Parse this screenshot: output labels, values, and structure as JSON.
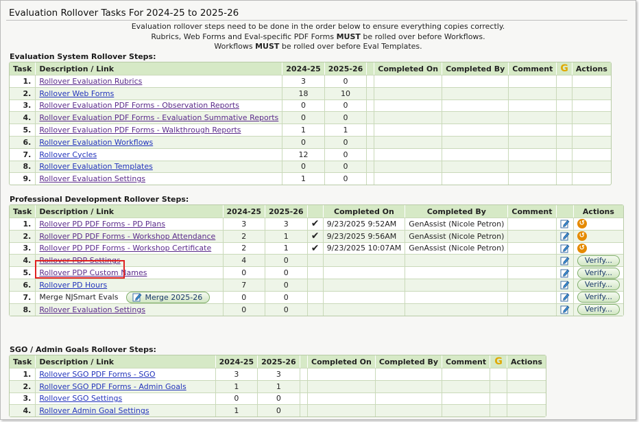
{
  "page": {
    "title": "Evaluation Rollover Tasks For 2024-25 to 2025-26",
    "intro_line1": "Evaluation rollover steps need to be done in the order below to ensure everything copies correctly.",
    "intro_line2_pre": "Rubrics, Web Forms and Eval-specific PDF Forms ",
    "intro_line2_bold": "MUST",
    "intro_line2_post": " be rolled over before Workflows.",
    "intro_line3_pre": "Workflows ",
    "intro_line3_bold": "MUST",
    "intro_line3_post": " be rolled over before Eval Templates."
  },
  "eval_section": {
    "label": "Evaluation System Rollover Steps:",
    "headers": {
      "task": "Task",
      "desc": "Description / Link",
      "y1": "2024-25",
      "y2": "2025-26",
      "completed_on": "Completed On",
      "completed_by": "Completed By",
      "comment": "Comment",
      "g": "G",
      "actions": "Actions"
    },
    "rows": [
      {
        "task": "1.",
        "desc": "Rollover Evaluation Rubrics",
        "y1": "3",
        "y2": "0",
        "visited": true
      },
      {
        "task": "2.",
        "desc": "Rollover Web Forms",
        "y1": "18",
        "y2": "10",
        "visited": false
      },
      {
        "task": "3.",
        "desc": "Rollover Evaluation PDF Forms - Observation Reports",
        "y1": "0",
        "y2": "0",
        "visited": true
      },
      {
        "task": "4.",
        "desc": "Rollover Evaluation PDF Forms - Evaluation Summative Reports",
        "y1": "0",
        "y2": "0",
        "visited": true
      },
      {
        "task": "5.",
        "desc": "Rollover Evaluation PDF Forms - Walkthrough Reports",
        "y1": "1",
        "y2": "1",
        "visited": true
      },
      {
        "task": "6.",
        "desc": "Rollover Evaluation Workflows",
        "y1": "0",
        "y2": "0",
        "visited": false
      },
      {
        "task": "7.",
        "desc": "Rollover Cycles",
        "y1": "12",
        "y2": "0",
        "visited": false
      },
      {
        "task": "8.",
        "desc": "Rollover Evaluation Templates",
        "y1": "0",
        "y2": "0",
        "visited": false
      },
      {
        "task": "9.",
        "desc": "Rollover Evaluation Settings",
        "y1": "1",
        "y2": "0",
        "visited": true
      }
    ]
  },
  "pd_section": {
    "label": "Professional Development Rollover Steps:",
    "headers": {
      "task": "Task",
      "desc": "Description / Link",
      "y1": "2024-25",
      "y2": "2025-26",
      "completed_on": "Completed On",
      "completed_by": "Completed By",
      "comment": "Comment",
      "actions": "Actions"
    },
    "verify_label": "Verify...",
    "merge_label": "Merge 2025-26",
    "rows": [
      {
        "task": "1.",
        "desc": "Rollover PD PDF Forms - PD Plans",
        "y1": "3",
        "y2": "3",
        "done": true,
        "completed_on": "9/23/2025 9:52AM",
        "completed_by": "GenAssist (Nicole Petron)",
        "visited": true
      },
      {
        "task": "2.",
        "desc": "Rollover PD PDF Forms - Workshop Attendance",
        "y1": "2",
        "y2": "1",
        "done": true,
        "completed_on": "9/23/2025 9:56AM",
        "completed_by": "GenAssist (Nicole Petron)",
        "visited": true
      },
      {
        "task": "3.",
        "desc": "Rollover PD PDF Forms - Workshop Certificate",
        "y1": "2",
        "y2": "1",
        "done": true,
        "completed_on": "9/23/2025 10:07AM",
        "completed_by": "GenAssist (Nicole Petron)",
        "visited": true
      },
      {
        "task": "4.",
        "desc": "Rollover PDP Settings",
        "y1": "4",
        "y2": "0",
        "done": false,
        "visited": true
      },
      {
        "task": "5.",
        "desc": "Rollover PDP Custom Names",
        "y1": "0",
        "y2": "0",
        "done": false,
        "visited": true
      },
      {
        "task": "6.",
        "desc": "Rollover PD Hours",
        "y1": "7",
        "y2": "0",
        "done": false,
        "visited": false
      },
      {
        "task": "7.",
        "desc": "Merge NJSmart Evals",
        "y1": "0",
        "y2": "0",
        "done": false,
        "is_merge": true
      },
      {
        "task": "8.",
        "desc": "Rollover Evaluation Settings",
        "y1": "0",
        "y2": "0",
        "done": false,
        "visited": true
      }
    ]
  },
  "sgo_section": {
    "label": "SGO / Admin Goals Rollover Steps:",
    "headers": {
      "task": "Task",
      "desc": "Description / Link",
      "y1": "2024-25",
      "y2": "2025-26",
      "completed_on": "Completed On",
      "completed_by": "Completed By",
      "comment": "Comment",
      "g": "G",
      "actions": "Actions"
    },
    "rows": [
      {
        "task": "1.",
        "desc": "Rollover SGO PDF Forms - SGO",
        "y1": "3",
        "y2": "3",
        "visited": false
      },
      {
        "task": "2.",
        "desc": "Rollover SGO PDF Forms - Admin Goals",
        "y1": "1",
        "y2": "1",
        "visited": false
      },
      {
        "task": "3.",
        "desc": "Rollover SGO Settings",
        "y1": "0",
        "y2": "0",
        "visited": false
      },
      {
        "task": "4.",
        "desc": "Rollover Admin Goal Settings",
        "y1": "1",
        "y2": "0",
        "visited": false
      }
    ]
  },
  "colors": {
    "header_bg": "#d6e9c6",
    "alt_row": "#eef5e8",
    "link": "#2233bb",
    "visited_link": "#5a2a8a",
    "highlight": "#e02020",
    "undo_icon": "#e58a00",
    "g_icon": "#e0a800"
  }
}
